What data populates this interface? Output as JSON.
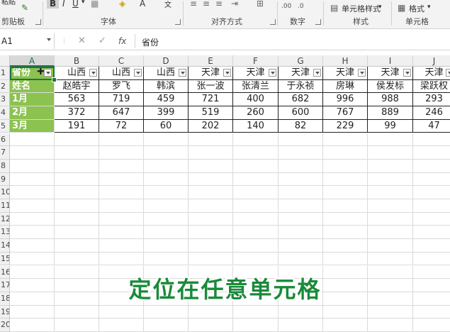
{
  "ribbon": {
    "clipboard_top": "粘贴",
    "clipboard_label": "剪贴板",
    "bold": "B",
    "italic": "I",
    "underline": "U",
    "font_label": "字体",
    "align_label": "对齐方式",
    "number_format": "数字",
    "cell_styles_button": "单元格样式",
    "styles_label": "样式",
    "format_button": "格式",
    "cells_label": "单元格"
  },
  "formula_bar": {
    "name_box": "A1",
    "cancel": "✕",
    "confirm": "✓",
    "fx": "fx",
    "value": "省份"
  },
  "columns": [
    "A",
    "B",
    "C",
    "D",
    "E",
    "F",
    "G",
    "H",
    "I",
    "J"
  ],
  "rows": [
    "1",
    "2",
    "3",
    "4",
    "5",
    "6",
    "7",
    "8",
    "9",
    "10",
    "11",
    "12",
    "13",
    "14",
    "15",
    "16",
    "17",
    "18",
    "19",
    "20"
  ],
  "sheet": {
    "row1": [
      "省份",
      "山西",
      "山西",
      "山西",
      "天津",
      "天津",
      "天津",
      "天津",
      "天津",
      "天津"
    ],
    "row2": [
      "姓名",
      "赵皓宇",
      "罗飞",
      "韩滨",
      "张一波",
      "张清兰",
      "于永祯",
      "房琳",
      "侯发标",
      "梁跃权"
    ],
    "row3": [
      "1月",
      "563",
      "719",
      "459",
      "721",
      "400",
      "682",
      "996",
      "988",
      "293"
    ],
    "row4": [
      "2月",
      "372",
      "647",
      "399",
      "519",
      "260",
      "600",
      "767",
      "889",
      "246"
    ],
    "row5": [
      "3月",
      "191",
      "72",
      "60",
      "202",
      "140",
      "82",
      "229",
      "99",
      "47"
    ]
  },
  "caption": "定位在任意单元格",
  "colors": {
    "accent": "#217346",
    "header_fill": "#8cc24f",
    "caption": "#1a8a3a"
  }
}
